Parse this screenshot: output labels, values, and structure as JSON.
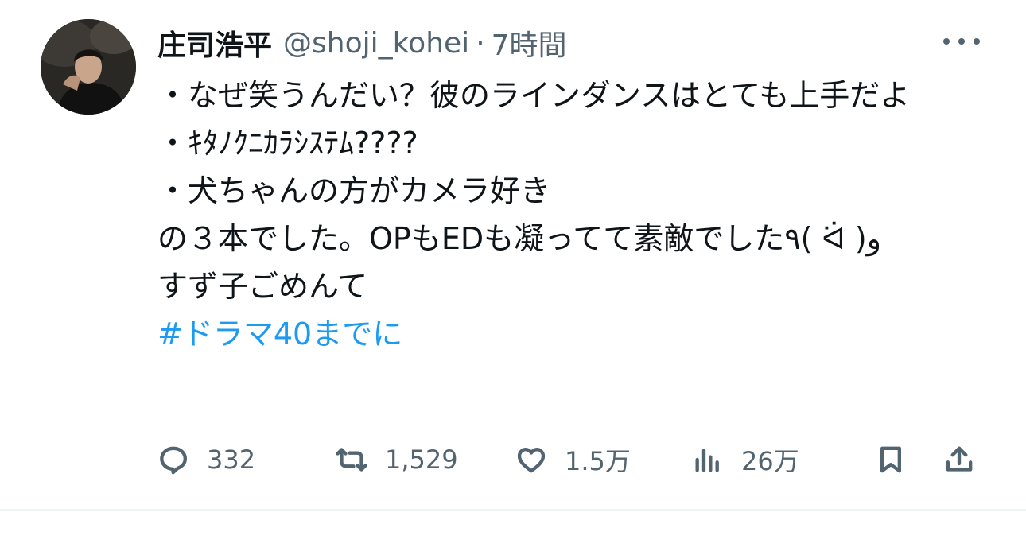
{
  "tweet": {
    "display_name": "庄司浩平",
    "handle": "@shoji_kohei",
    "separator": "·",
    "time": "7時間",
    "lines": [
      "・なぜ笑うんだい？彼のラインダンスはとても上手だよ",
      "・ｷﾀﾉｸﾆｶﾗｼｽﾃﾑ????",
      "・犬ちゃんの方がカメラ好き",
      "の３本でした。OPもEDも凝ってて素敵でした٩( ᐛ )و",
      "すず子ごめんて"
    ],
    "hashtag": "#ドラマ40までに"
  },
  "actions": {
    "reply": {
      "icon": "reply-icon",
      "count": "332"
    },
    "repost": {
      "icon": "repost-icon",
      "count": "1,529"
    },
    "like": {
      "icon": "heart-icon",
      "count": "1.5万"
    },
    "views": {
      "icon": "views-icon",
      "count": "26万"
    },
    "bookmark": {
      "icon": "bookmark-icon"
    },
    "share": {
      "icon": "share-icon"
    }
  },
  "colors": {
    "text": "#0f1419",
    "secondary": "#536471",
    "link": "#1d9bf0",
    "divider": "#eff3f4"
  }
}
